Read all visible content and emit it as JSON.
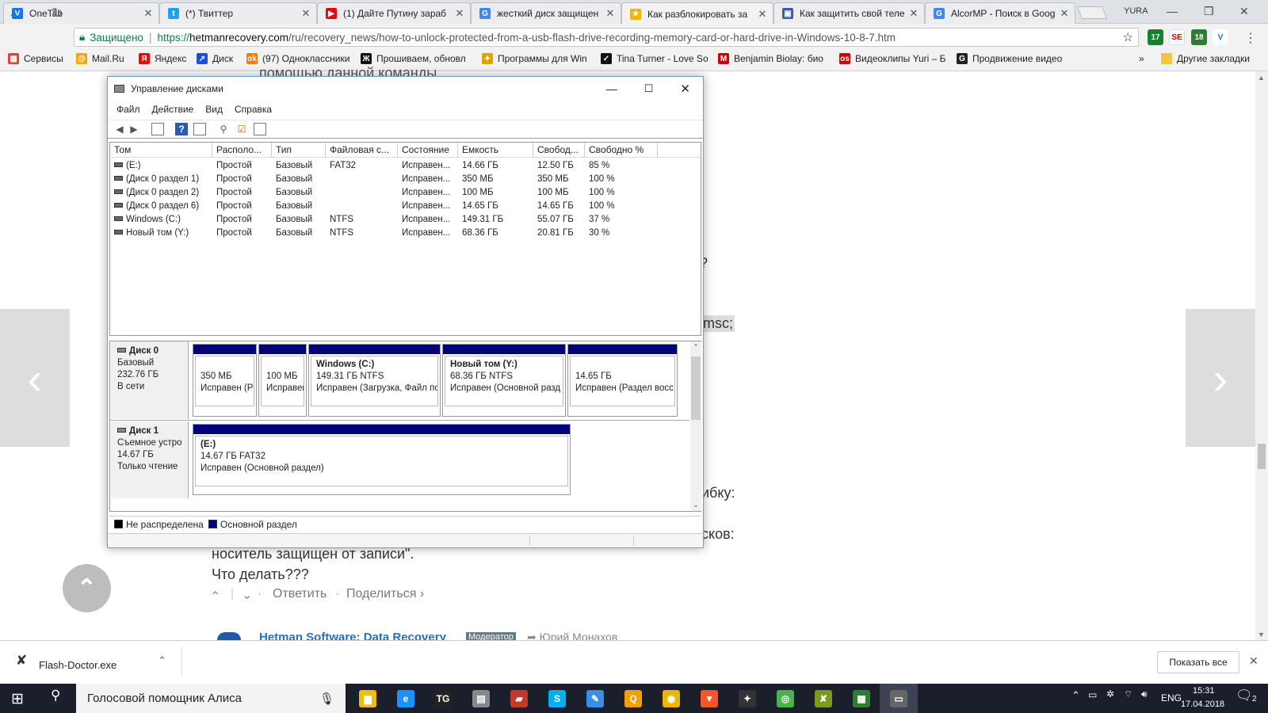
{
  "browser": {
    "tabs": [
      {
        "title": "OneTab",
        "color": "#1a73e8",
        "glyph": "V"
      },
      {
        "title": "(*) Твиттер",
        "color": "#1da1f2",
        "glyph": "t"
      },
      {
        "title": "(1) Дайте Путину зараб",
        "color": "#e00",
        "glyph": "▶"
      },
      {
        "title": "жесткий диск защищен",
        "color": "#4285f4",
        "glyph": "G"
      },
      {
        "title": "Как разблокировать за",
        "color": "#f4b400",
        "glyph": "★"
      },
      {
        "title": "Как защитить свой теле",
        "color": "#3b5ba5",
        "glyph": "▣"
      },
      {
        "title": "AlcorMP - Поиск в Goog",
        "color": "#4285f4",
        "glyph": "G"
      }
    ],
    "profile": "YURA",
    "security_label": "Защищено",
    "url_scheme": "https://",
    "url_host": "hetmanrecovery.com",
    "url_path": "/ru/recovery_news/how-to-unlock-protected-from-a-usb-flash-drive-recording-memory-card-or-hard-drive-in-Windows-10-8-7.htm",
    "extension_badges": [
      "17",
      "18"
    ],
    "bookmarks": [
      {
        "label": "Сервисы",
        "color": "#db4437",
        "glyph": "▦"
      },
      {
        "label": "Mail.Ru",
        "color": "#f7a600",
        "glyph": "@"
      },
      {
        "label": "Яндекс",
        "color": "#ff0000",
        "glyph": "Я"
      },
      {
        "label": "Диск",
        "color": "#1d4ed8",
        "glyph": "↗"
      },
      {
        "label": "(97) Одноклассники",
        "color": "#ee8208",
        "glyph": "ok"
      },
      {
        "label": "Прошиваем, обновл",
        "color": "#111",
        "glyph": "Ж"
      },
      {
        "label": "Программы для Win",
        "color": "#e0a100",
        "glyph": "✦"
      },
      {
        "label": "Tina Turner - Love So",
        "color": "#111",
        "glyph": "✓"
      },
      {
        "label": "Benjamin Biolay: био",
        "color": "#c00",
        "glyph": "M"
      },
      {
        "label": "Видеоклипы Yuri – Б",
        "color": "#c00",
        "glyph": "os"
      },
      {
        "label": "Продвижение видео",
        "color": "#222",
        "glyph": "G"
      }
    ],
    "bookmarks_overflow": "»",
    "other_bookmarks": "Другие закладки"
  },
  "page": {
    "line_top": "помощью данной команды",
    "question_mark": "?",
    "msc_text": "t.msc;",
    "error_fragment": "ибку:",
    "disks_fragment": "сков:",
    "comment_line1": "носитель защищен от записи\".",
    "comment_line2": "Что делать???",
    "reply": "Ответить",
    "share": "Поделиться ›",
    "author": "Hetman Software: Data Recovery",
    "role_badge": "Модератор",
    "reply_to": "Юрий Монахов"
  },
  "dialog": {
    "title": "Управление дисками",
    "menu": [
      "Файл",
      "Действие",
      "Вид",
      "Справка"
    ],
    "columns": [
      "Том",
      "Располо...",
      "Тип",
      "Файловая с...",
      "Состояние",
      "Емкость",
      "Свобод...",
      "Свободно %"
    ],
    "volumes": [
      [
        "(E:)",
        "Простой",
        "Базовый",
        "FAT32",
        "Исправен...",
        "14.66 ГБ",
        "12.50 ГБ",
        "85 %"
      ],
      [
        "(Диск 0 раздел 1)",
        "Простой",
        "Базовый",
        "",
        "Исправен...",
        "350 МБ",
        "350 МБ",
        "100 %"
      ],
      [
        "(Диск 0 раздел 2)",
        "Простой",
        "Базовый",
        "",
        "Исправен...",
        "100 МБ",
        "100 МБ",
        "100 %"
      ],
      [
        "(Диск 0 раздел 6)",
        "Простой",
        "Базовый",
        "",
        "Исправен...",
        "14.65 ГБ",
        "14.65 ГБ",
        "100 %"
      ],
      [
        "Windows (C:)",
        "Простой",
        "Базовый",
        "NTFS",
        "Исправен...",
        "149.31 ГБ",
        "55.07 ГБ",
        "37 %"
      ],
      [
        "Новый том (Y:)",
        "Простой",
        "Базовый",
        "NTFS",
        "Исправен...",
        "68.36 ГБ",
        "20.81 ГБ",
        "30 %"
      ]
    ],
    "disk0": {
      "name": "Диск 0",
      "type": "Базовый",
      "size": "232.76 ГБ",
      "status": "В сети",
      "partitions": [
        {
          "name": "",
          "size": "350 МБ",
          "status": "Исправен (Р"
        },
        {
          "name": "",
          "size": "100 МБ",
          "status": "Исправен"
        },
        {
          "name": "Windows  (C:)",
          "size": "149.31 ГБ NTFS",
          "status": "Исправен (Загрузка, Файл по"
        },
        {
          "name": "Новый том  (Y:)",
          "size": "68.36 ГБ NTFS",
          "status": "Исправен (Основной разд"
        },
        {
          "name": "",
          "size": "14.65 ГБ",
          "status": "Исправен (Раздел восс"
        }
      ]
    },
    "disk1": {
      "name": "Диск 1",
      "type": "Съемное устро",
      "size": "14.67 ГБ",
      "status": "Только чтение",
      "partition": {
        "name": "(E:)",
        "size": "14.67 ГБ FAT32",
        "status": "Исправен (Основной раздел)"
      }
    },
    "legend": [
      {
        "label": "Не распределена",
        "color": "#000000"
      },
      {
        "label": "Основной раздел",
        "color": "#00007f"
      }
    ]
  },
  "download": {
    "file": "Flash-Doctor.exe",
    "show_all": "Показать все"
  },
  "taskbar": {
    "search": "Голосовой помощник Алиса",
    "lang": "ENG",
    "time": "15:31",
    "date": "17.04.2018",
    "notifications": "2"
  }
}
